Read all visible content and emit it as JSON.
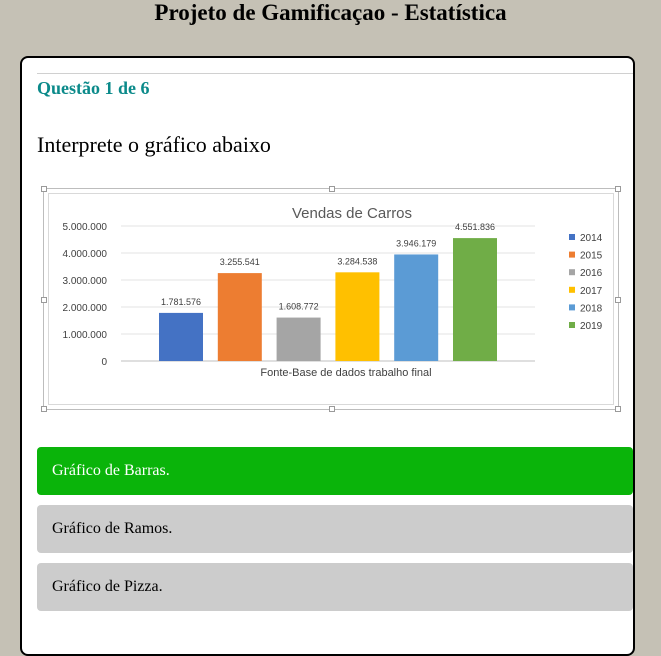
{
  "page": {
    "title": "Projeto de Gamificaçao - Estatística"
  },
  "question": {
    "counter": "Questão 1 de 6",
    "prompt": "Interprete o gráfico abaixo"
  },
  "chart_data": {
    "type": "bar",
    "title": "Vendas de Carros",
    "xlabel": "Fonte-Base de dados trabalho final",
    "ylabel": "",
    "ylim": [
      0,
      5000000
    ],
    "y_ticks": [
      "0",
      "1.000.000",
      "2.000.000",
      "3.000.000",
      "4.000.000",
      "5.000.000"
    ],
    "legend_position": "right",
    "grid": true,
    "series": [
      {
        "name": "2014",
        "value": 1781576,
        "label": "1.781.576",
        "color": "#4472c4"
      },
      {
        "name": "2015",
        "value": 3255541,
        "label": "3.255.541",
        "color": "#ed7d31"
      },
      {
        "name": "2016",
        "value": 1608772,
        "label": "1.608.772",
        "color": "#a5a5a5"
      },
      {
        "name": "2017",
        "value": 3284538,
        "label": "3.284.538",
        "color": "#ffc000"
      },
      {
        "name": "2018",
        "value": 3946179,
        "label": "3.946.179",
        "color": "#5b9bd5"
      },
      {
        "name": "2019",
        "value": 4551836,
        "label": "4.551.836",
        "color": "#70ad47"
      }
    ]
  },
  "answers": [
    {
      "label": "Gráfico de Barras.",
      "selected": true
    },
    {
      "label": "Gráfico de Ramos.",
      "selected": false
    },
    {
      "label": "Gráfico de Pizza.",
      "selected": false
    }
  ],
  "colors": {
    "accent": "#0b8a8a",
    "selected_answer": "#0ab40a",
    "answer_bg": "#cccccc",
    "page_bg": "#c5c1b5"
  }
}
